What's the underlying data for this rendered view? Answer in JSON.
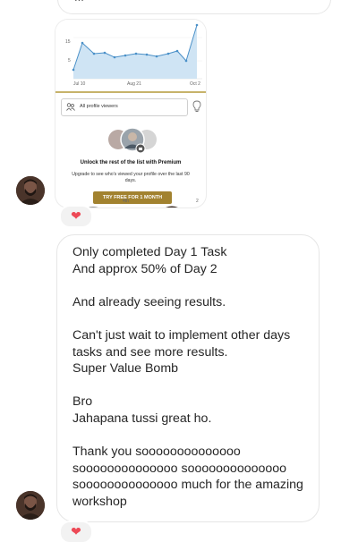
{
  "top_bubble": {
    "text": "..."
  },
  "shared_image": {
    "chart": {
      "y_ticks": [
        "15",
        "5"
      ],
      "x_ticks": [
        "Jul 10",
        "Aug 21",
        "Oct 2"
      ]
    },
    "filter_label": "All profile viewers",
    "unlock_title": "Unlock the rest of the list with Premium",
    "upgrade_text_line1": "Upgrade to see who's viewed your profile over the last 90",
    "upgrade_text_line2": "days.",
    "cta_button": "TRY FREE FOR 1 MONTH",
    "peek_text": "4th",
    "peek_text2": "2"
  },
  "reaction_emoji": "❤",
  "message": {
    "lines": [
      "Only completed Day 1 Task",
      "And approx 50% of Day 2",
      "",
      "And already seeing results.",
      "",
      "Can't just wait to implement other days",
      "tasks and see more results.",
      "Super Value Bomb",
      "",
      "Bro",
      "Jahapana tussi great ho.",
      "",
      "Thank you soooooooooooooo",
      "soooooooooooooo soooooooooooooo",
      "soooooooooooooo much for the amazing",
      "workshop"
    ]
  },
  "colors": {
    "bubble_border": "#e6e6e6",
    "heart": "#ed4956",
    "premium_gold": "#a2822f",
    "chart_line": "#4a90c8"
  }
}
